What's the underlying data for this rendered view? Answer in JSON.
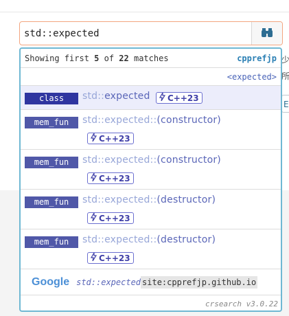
{
  "search": {
    "value": "std::expected",
    "button_icon": "binoculars-icon"
  },
  "header": {
    "prefix": "Showing first ",
    "shown": "5",
    "middle": " of ",
    "total": "22",
    "suffix": " matches",
    "brand": "cpprefjp"
  },
  "header_link": "<expected>",
  "items": [
    {
      "kind": "class",
      "ns": "std::",
      "id": "expected",
      "badge": "C++23",
      "selected": true
    },
    {
      "kind": "mem_fun",
      "ns": "std::expected::",
      "id": "(constructor)",
      "badge": "C++23"
    },
    {
      "kind": "mem_fun",
      "ns": "std::expected::",
      "id": "(constructor)",
      "badge": "C++23"
    },
    {
      "kind": "mem_fun",
      "ns": "std::expected::",
      "id": "(destructor)",
      "badge": "C++23"
    },
    {
      "kind": "mem_fun",
      "ns": "std::expected::",
      "id": "(destructor)",
      "badge": "C++23"
    }
  ],
  "google": {
    "label": "Google",
    "query": "std::expected",
    "site": "site:cpprefjp.github.io"
  },
  "footer": "crsearch v3.0.22",
  "background": {
    "right_char_1": "少",
    "right_char_2": "所",
    "right_btn": "E"
  },
  "colors": {
    "accent": "#6fb8d3",
    "kind_bg": "#5058a8",
    "badge_border": "#6b6fd0",
    "input_border": "#f3a57f"
  }
}
